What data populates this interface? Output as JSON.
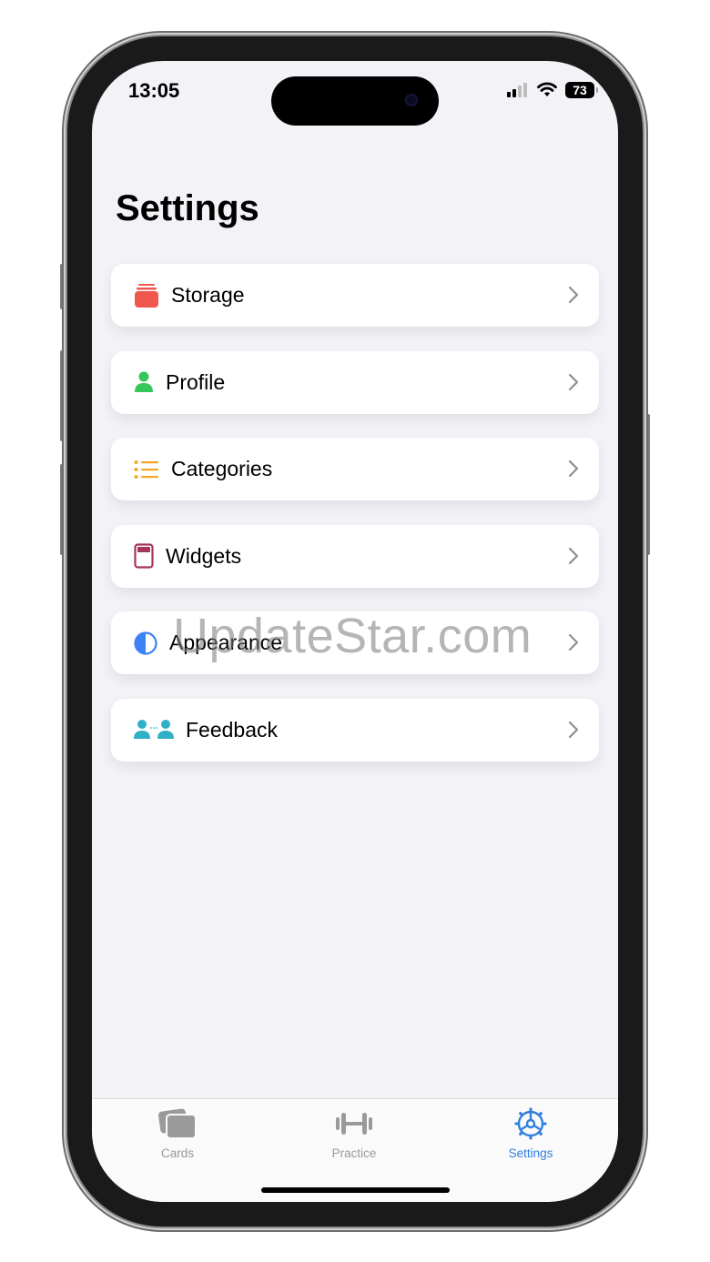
{
  "status_bar": {
    "time": "13:05",
    "battery": "73"
  },
  "page": {
    "title": "Settings"
  },
  "settings_items": [
    {
      "label": "Storage",
      "icon": "storage-icon",
      "color": "#f0574f"
    },
    {
      "label": "Profile",
      "icon": "person-icon",
      "color": "#34c759"
    },
    {
      "label": "Categories",
      "icon": "list-icon",
      "color": "#f5a623"
    },
    {
      "label": "Widgets",
      "icon": "widget-icon",
      "color": "#a3355b"
    },
    {
      "label": "Appearance",
      "icon": "contrast-icon",
      "color": "#3b82f6"
    },
    {
      "label": "Feedback",
      "icon": "people-chat-icon",
      "color": "#30b0c7"
    }
  ],
  "tabs": [
    {
      "label": "Cards",
      "icon": "cards-icon",
      "active": false
    },
    {
      "label": "Practice",
      "icon": "dumbbell-icon",
      "active": false
    },
    {
      "label": "Settings",
      "icon": "gear-icon",
      "active": true
    }
  ],
  "colors": {
    "accent": "#2f7fe0",
    "inactive": "#9a9a9a"
  },
  "watermark": "UpdateStar.com"
}
